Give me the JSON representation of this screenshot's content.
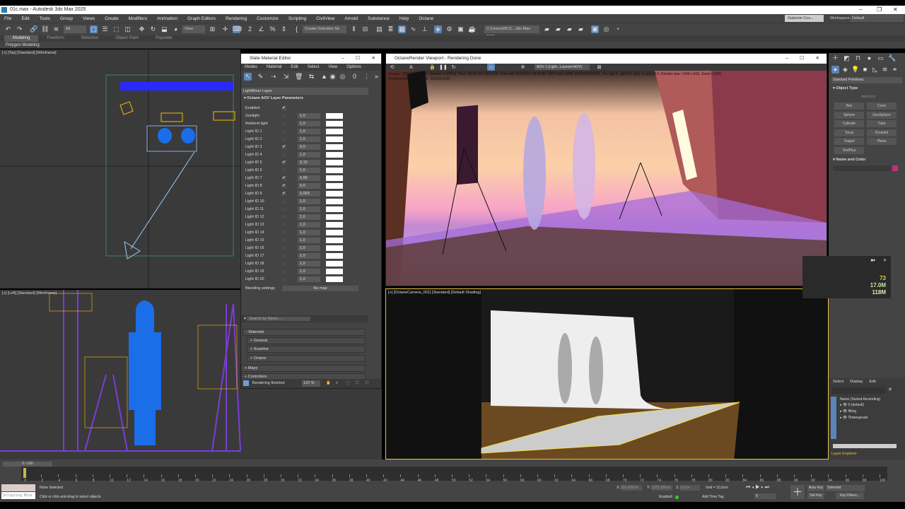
{
  "window": {
    "title": "01c.max - Autodesk 3ds Max 2025",
    "minimize": "–",
    "restore": "❐",
    "close": "✕"
  },
  "menu": [
    "File",
    "Edit",
    "Tools",
    "Group",
    "Views",
    "Create",
    "Modifiers",
    "Animation",
    "Graph Editors",
    "Rendering",
    "Customize",
    "Scripting",
    "CivilView",
    "Arnold",
    "Substance",
    "Help",
    "Octane"
  ],
  "user": {
    "name": "Gabriele Cos...",
    "workspaces_label": "Workspaces:",
    "workspace": "Default"
  },
  "toolbar": {
    "selection_filter": "All",
    "ref_coord": "View",
    "selection_set": "Create Selection Se",
    "project_path": "C:\\Users\\WCIL...3ds Max 2025"
  },
  "ribbon": {
    "tabs": [
      "Modeling",
      "Freeform",
      "Selection",
      "Object Paint",
      "Populate"
    ],
    "active": "Modeling",
    "panel": "Polygon Modeling"
  },
  "viewports": {
    "top": "[+] [Top] [Standard] [Wireframe]",
    "left": "[+] [Left] [Standard] [Wireframe]",
    "camera": "[+] [OctaneCamera_001] [Standard] [Default Shading]"
  },
  "slate": {
    "title": "Slate Material Editor",
    "menu": [
      "Modes",
      "Material",
      "Edit",
      "Select",
      "View",
      "Options"
    ],
    "node_title": "LightMixer Layer",
    "rollout": "Octane AOV Layer Parameters",
    "enabled_label": "Enabled",
    "rows": [
      {
        "label": "Sunlight",
        "checked": false,
        "value": "1,0"
      },
      {
        "label": "Ambient light",
        "checked": false,
        "value": "1,0"
      },
      {
        "label": "Light ID 1",
        "checked": false,
        "value": "1,0"
      },
      {
        "label": "Light ID 2",
        "checked": false,
        "value": "1,0"
      },
      {
        "label": "Light ID 3",
        "checked": true,
        "value": "0,0"
      },
      {
        "label": "Light ID 4",
        "checked": false,
        "value": "1,0"
      },
      {
        "label": "Light ID 5",
        "checked": true,
        "value": "0,19"
      },
      {
        "label": "Light ID 6",
        "checked": false,
        "value": "1,0"
      },
      {
        "label": "Light ID 7",
        "checked": true,
        "value": "0,99"
      },
      {
        "label": "Light ID 8",
        "checked": true,
        "value": "0,0"
      },
      {
        "label": "Light ID 9",
        "checked": true,
        "value": "0,093"
      },
      {
        "label": "Light ID 10",
        "checked": false,
        "value": "1,0"
      },
      {
        "label": "Light ID 11",
        "checked": false,
        "value": "1,0"
      },
      {
        "label": "Light ID 12",
        "checked": false,
        "value": "1,0"
      },
      {
        "label": "Light ID 13",
        "checked": false,
        "value": "1,0"
      },
      {
        "label": "Light ID 14",
        "checked": false,
        "value": "1,0"
      },
      {
        "label": "Light ID 15",
        "checked": false,
        "value": "1,0"
      },
      {
        "label": "Light ID 16",
        "checked": false,
        "value": "1,0"
      },
      {
        "label": "Light ID 17",
        "checked": false,
        "value": "1,0"
      },
      {
        "label": "Light ID 18",
        "checked": false,
        "value": "1,0"
      },
      {
        "label": "Light ID 19",
        "checked": false,
        "value": "1,0"
      },
      {
        "label": "Light ID 20",
        "checked": false,
        "value": "1,0"
      }
    ],
    "blending_label": "Blending settings",
    "blending_value": "No map",
    "search_placeholder": "Search by Name ...",
    "browser": [
      "- Materials",
      "+ General",
      "+ Scanline",
      "+ Octane",
      "+ Maps",
      "+ Controllers"
    ],
    "status": "Rendering finished",
    "zoom": "122 %"
  },
  "octane": {
    "title": "OctaneRender Viewport - Rendering Done",
    "aov": "AOV 1 (Light...Layered AOV)",
    "stats1": "Smp/px: 2000/2000/2000,  Sample: 0,0000s,  Time: 00:01:24 / 00:01:24,  Time left: 00:00:00 / 00:00:00,  GPU mem [MB]: 2814/8020/8191,  Tex: rgb 8, rgb64 0, grey 3, grey16 0,  Render size: 1244 x 603,  Zoom: 100%",
    "stats2": "Primitives/Meshes/Voxels: 3002/2/2530"
  },
  "perf": {
    "fps": "73",
    "mem1": "17.0M",
    "mem2": "118M"
  },
  "command_panel": {
    "category": "Standard Primitives",
    "object_type": "Object Type",
    "autogrid": "AutoGrid",
    "buttons": [
      "Box",
      "Cone",
      "Sphere",
      "GeoSphere",
      "Cylinder",
      "Tube",
      "Torus",
      "Pyramid",
      "Teapot",
      "Plane",
      "TextPlus"
    ],
    "name_color": "Name and Color",
    "object_color": "#c2307a"
  },
  "scene_explorer": {
    "menu": [
      "Select",
      "Display",
      "Edit"
    ],
    "header": "Name (Sorted Ascending)",
    "layers": [
      "0 (default)",
      "filling",
      "Помещение"
    ],
    "footer": "Layer Explorer"
  },
  "timeline": {
    "frame": "0 / 100",
    "start": 0,
    "end": 100,
    "step": 2
  },
  "status": {
    "script_label": "Scripting Mini",
    "selection": "None Selected",
    "prompt": "Click or click-and-drag to select objects",
    "x_label": "X:",
    "x": "333,428cm",
    "y_label": "Y:",
    "y": "1329,188cm",
    "z_label": "Z:",
    "z": "0,0cm",
    "grid": "Grid = 10,0cm",
    "enabled_label": "Enabled:",
    "add_time_tag": "Add Time Tag",
    "auto_key": "Auto Key",
    "set_key": "Set Key",
    "key_mode": "Selected",
    "key_filters": "Key Filters...",
    "frame_field": "0"
  }
}
